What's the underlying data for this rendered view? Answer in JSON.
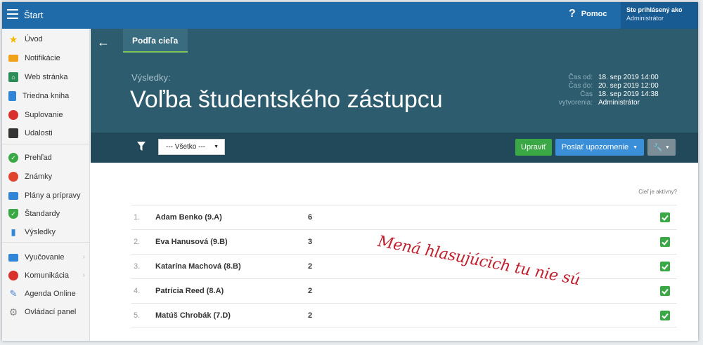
{
  "topbar": {
    "title": "Štart",
    "help_label": "Pomoc",
    "user_line1": "Ste prihlásený ako",
    "user_line2": "Administrátor",
    "color": "#1f6aa8"
  },
  "sidebar": {
    "items": [
      {
        "label": "Úvod",
        "icon": "star-icon",
        "color": "#f5b800"
      },
      {
        "label": "Notifikácie",
        "icon": "envelope-icon",
        "color": "#f0a21b"
      },
      {
        "label": "Web stránka",
        "icon": "home-icon",
        "color": "#2a8c56"
      },
      {
        "label": "Triedna kniha",
        "icon": "book-icon",
        "color": "#2f86d6"
      },
      {
        "label": "Suplovanie",
        "icon": "person-icon",
        "color": "#d9302c"
      },
      {
        "label": "Udalosti",
        "icon": "calendar-icon",
        "color": "#333333"
      },
      {
        "label": "Prehľad",
        "icon": "check-circle-icon",
        "color": "#3aa845"
      },
      {
        "label": "Známky",
        "icon": "grade-icon",
        "color": "#e0442f"
      },
      {
        "label": "Plány a prípravy",
        "icon": "briefcase-icon",
        "color": "#2f86d6"
      },
      {
        "label": "Štandardy",
        "icon": "shield-icon",
        "color": "#3aa845"
      },
      {
        "label": "Výsledky",
        "icon": "bar-chart-icon",
        "color": "#2f86d6"
      },
      {
        "label": "Vyučovanie",
        "icon": "teaching-icon",
        "color": "#2f86d6"
      },
      {
        "label": "Komunikácia",
        "icon": "chat-icon",
        "color": "#d9302c"
      },
      {
        "label": "Agenda Online",
        "icon": "pen-icon",
        "color": "#4a7fd1"
      },
      {
        "label": "Ovládací panel",
        "icon": "gear-icon",
        "color": "#888888"
      }
    ]
  },
  "header": {
    "tab_label": "Podľa cieľa",
    "results_label": "Výsledky:",
    "title": "Voľba študentského zástupcu",
    "meta": [
      {
        "key": "Čas od:",
        "value": "18. sep 2019 14:00"
      },
      {
        "key": "Čas do:",
        "value": "20. sep 2019 12:00"
      },
      {
        "key": "Čas",
        "value": "18. sep 2019 14:38"
      },
      {
        "key": "vytvorenia:",
        "value": "Administrátor"
      }
    ]
  },
  "toolbar": {
    "filter_value": "--- Všetko ---",
    "edit_label": "Upraviť",
    "notify_label": "Poslať upozornenie"
  },
  "results": {
    "active_header": "Cieľ je aktívny?",
    "rows": [
      {
        "rank": "1.",
        "name": "Adam Benko (9.A)",
        "votes": "6",
        "active": true
      },
      {
        "rank": "2.",
        "name": "Eva Hanusová (9.B)",
        "votes": "3",
        "active": true
      },
      {
        "rank": "3.",
        "name": "Katarína Machová (8.B)",
        "votes": "2",
        "active": true
      },
      {
        "rank": "4.",
        "name": "Patrícia Reed (8.A)",
        "votes": "2",
        "active": true
      },
      {
        "rank": "5.",
        "name": "Matúš Chrobák (7.D)",
        "votes": "2",
        "active": true
      }
    ]
  },
  "annotation": "Mená hlasujúcich tu nie sú"
}
